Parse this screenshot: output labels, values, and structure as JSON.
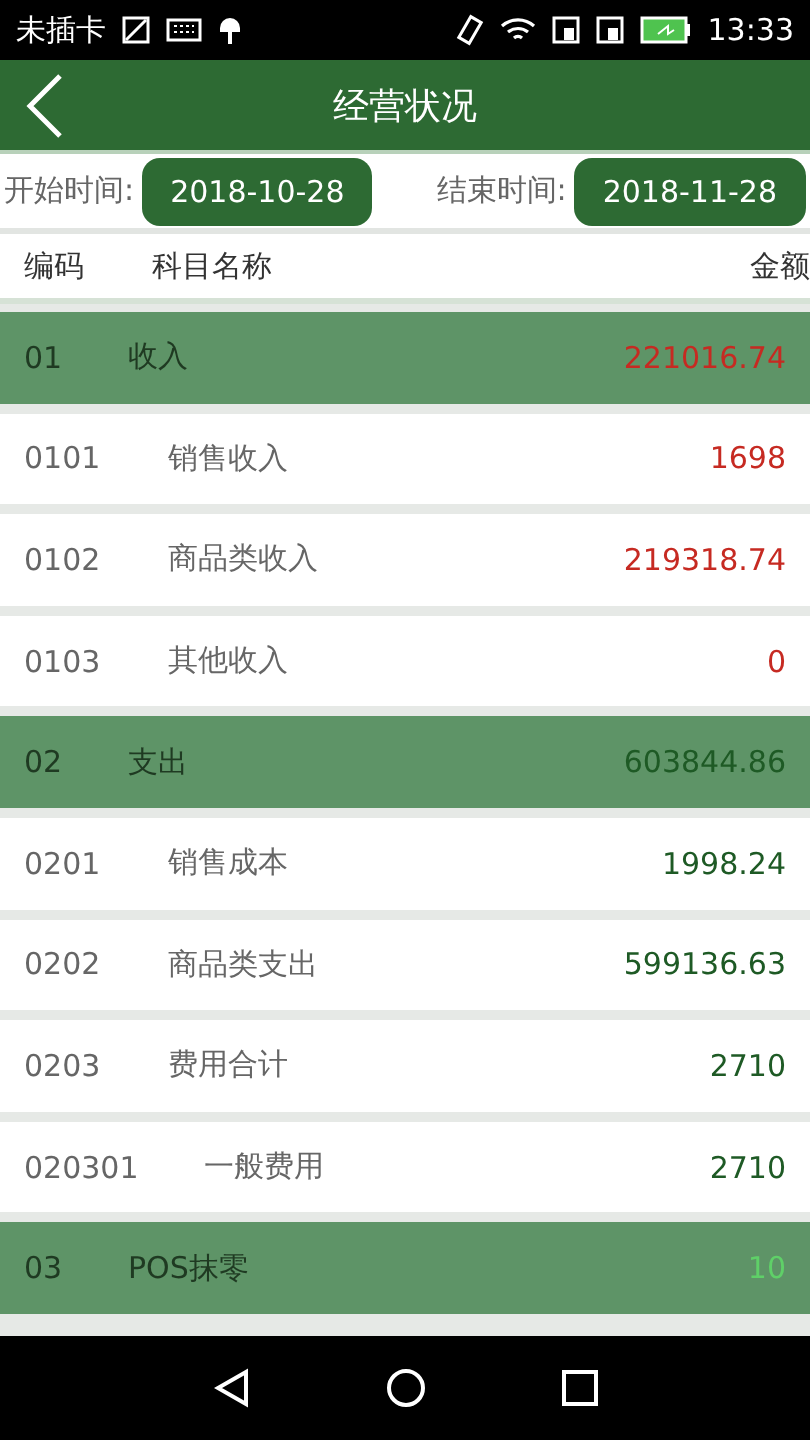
{
  "status_bar": {
    "carrier": "未插卡",
    "time": "13:33"
  },
  "header": {
    "title": "经营状况"
  },
  "date_range": {
    "start_label": "开始时间:",
    "start_value": "2018-10-28",
    "end_label": "结束时间:",
    "end_value": "2018-11-28"
  },
  "table": {
    "columns": [
      "编码",
      "科目名称",
      "金额"
    ],
    "rows": [
      {
        "code": "01",
        "name": "收入",
        "amount": "221016.74",
        "color": "#c62a22",
        "children": [
          {
            "code": "0101",
            "name": "销售收入",
            "amount": "1698",
            "color": "#c62a22"
          },
          {
            "code": "0102",
            "name": "商品类收入",
            "amount": "219318.74",
            "color": "#c62a22"
          },
          {
            "code": "0103",
            "name": "其他收入",
            "amount": "0",
            "color": "#c62a22"
          }
        ]
      },
      {
        "code": "02",
        "name": "支出",
        "amount": "603844.86",
        "color": "#1e5a25",
        "children": [
          {
            "code": "0201",
            "name": "销售成本",
            "amount": "1998.24",
            "color": "#1e5a25"
          },
          {
            "code": "0202",
            "name": "商品类支出",
            "amount": "599136.63",
            "color": "#1e5a25"
          },
          {
            "code": "0203",
            "name": "费用合计",
            "amount": "2710",
            "color": "#1e5a25",
            "children": [
              {
                "code": "020301",
                "name": "一般费用",
                "amount": "2710",
                "color": "#1e5a25"
              }
            ]
          }
        ]
      },
      {
        "code": "03",
        "name": "POS抹零",
        "amount": "10",
        "color": "#5fd068"
      }
    ]
  }
}
